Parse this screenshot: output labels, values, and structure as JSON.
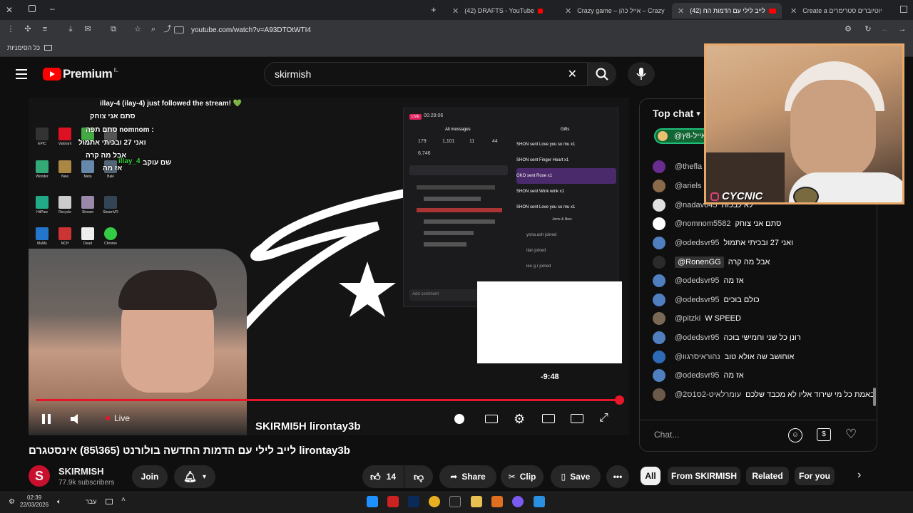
{
  "browser": {
    "tabs": [
      {
        "title": "(42) DRAFTS - YouTube"
      },
      {
        "title": "Crazy game – אייל כהן – Crazy g"
      },
      {
        "title": "(42) לייב לילי עם הדמות הח"
      },
      {
        "title": "Create a יוטיוברים סטרימרים"
      }
    ],
    "url": "youtube.com/watch?v=A93DTOtWTI4",
    "bookmarks_label": "כל הסימניות"
  },
  "header": {
    "logo_text": "Premium",
    "region": "IL",
    "search_value": "skirmish"
  },
  "video": {
    "title": "לייב לילי עם הדמות החדשה בולורנט (365\\85) אינסטגרם lirontay3b",
    "stream_overlay": {
      "follow_line": "illay-4 (ilay-4) just followed the stream! 💚",
      "lines": [
        "סתם אני צוחק",
        "סתם תפה nomnom :",
        "ואני 27 ובכיתי אתמול",
        "אבל מה קרה",
        "אז מה",
        "שם עוקב"
      ],
      "user_tag": "illay_4",
      "socials_text": "SKIRMI5H  lirontay3b",
      "live_timer": "00:28:06",
      "stats": {
        "viewers": "179",
        "likes": "1,101",
        "gifts": "11",
        "shares": "44",
        "hearts": "6,746"
      },
      "tab_all": "All messages",
      "tab_gifts": "Gifts",
      "gifts": [
        "SHON sent Love you so mu x1",
        "SHON sent Finger Heart x1",
        "GKO sent Rose x1",
        "SHON sent Wink wink x1",
        "SHON sent Love you so mu x1"
      ],
      "joins_label": "Joins & likes",
      "joins": [
        "yona.ash joined",
        "Ilan joined",
        "leo g.r joined"
      ],
      "comment_placeholder": "Add comment",
      "countdown": "-9:48",
      "live_badge": "LIVE"
    },
    "controls": {
      "live_label": "Live",
      "progress": 1.0
    }
  },
  "channel": {
    "name": "SKIRMISH",
    "subscribers": "77.9k subscribers",
    "join_label": "Join",
    "likes": "14",
    "share_label": "Share",
    "clip_label": "Clip",
    "save_label": "Save"
  },
  "chips": [
    "All",
    "From SKIRMISH",
    "Related",
    "For you"
  ],
  "chat": {
    "mode_label": "Top chat",
    "pinned_user": "@אייל-8ץ",
    "messages": [
      {
        "author": "@thefla",
        "text": "לך לגדול",
        "color": "#6a2c91"
      },
      {
        "author": "@ariels",
        "text": "",
        "color": "#8b6a4a"
      },
      {
        "author": "@nadav645",
        "text": "לא לבכות",
        "color": "#e0e0e0"
      },
      {
        "author": "@nomnom5582",
        "text": "סתם אני צוחק",
        "color": "#ffffff"
      },
      {
        "author": "@odedsvr95",
        "text": "ואני 27 ובכיתי אתמול",
        "color": "#4f7fbf"
      },
      {
        "author": "@RonenGG",
        "text": "אבל מה קרה",
        "color": "#2b2b2b"
      },
      {
        "author": "@odedsvr95",
        "text": "אז מה",
        "color": "#4f7fbf"
      },
      {
        "author": "@odedsvr95",
        "text": "כולם בוכים",
        "color": "#4f7fbf"
      },
      {
        "author": "@pitzki",
        "text": "W SPEED",
        "color": "#7a6a55"
      },
      {
        "author": "@odedsvr95",
        "text": "רונן כל שני וחמישי בוכה",
        "color": "#4f7fbf"
      },
      {
        "author": "@נהוראיסרגוו",
        "text": "אוחושב שה אולא טוב",
        "color": "#2e6bb7"
      },
      {
        "author": "@odedsvr95",
        "text": "אז מה",
        "color": "#4f7fbf"
      },
      {
        "author": "@עומרלאיט-2ס1ס2",
        "text": "באמת כל מי שירוד אליו לא מכבד שלכם",
        "color": "#6b5a4a"
      }
    ],
    "input_placeholder": "Chat..."
  },
  "cam": {
    "name": "CYCNIC"
  },
  "taskbar": {
    "time": "02:39",
    "date": "22/03/2026",
    "lang": "עבר"
  },
  "colors": {
    "youtube_red": "#ff0000",
    "progress_red": "#e8162b",
    "background": "#0f0f0f"
  }
}
